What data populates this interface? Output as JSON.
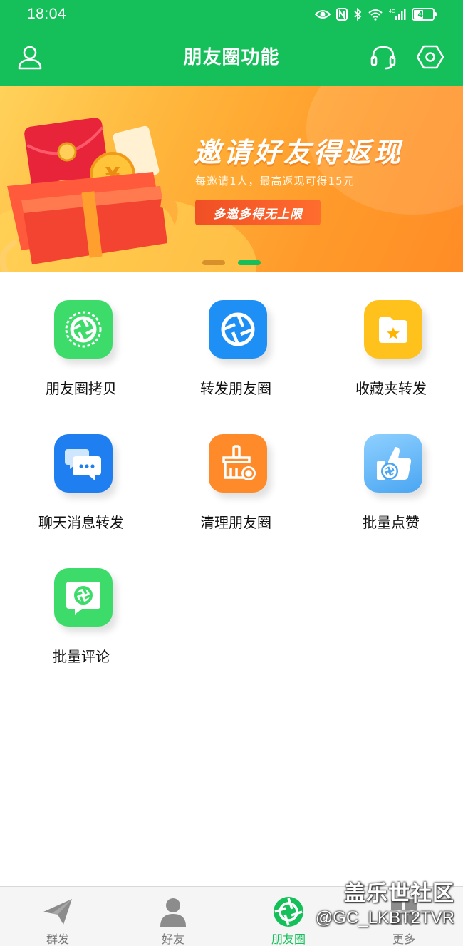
{
  "status_bar": {
    "time": "18:04",
    "network": "4G",
    "battery": "47"
  },
  "header": {
    "title": "朋友圈功能",
    "left_icon": "user-icon",
    "right_icons": [
      "headset-icon",
      "settings-hexagon-icon"
    ],
    "color": "#15c05a"
  },
  "banner": {
    "headline": "邀请好友得返现",
    "subtitle": "每邀请1人，最高返现可得15元",
    "button_label": "多邀多得无上限",
    "active_slide": 2,
    "slide_count": 2
  },
  "features": [
    {
      "label": "朋友圈拷贝",
      "icon": "shutter-copy-icon",
      "color": "#3ddc6a"
    },
    {
      "label": "转发朋友圈",
      "icon": "shutter-forward-icon",
      "color": "#1e8ff5"
    },
    {
      "label": "收藏夹转发",
      "icon": "folder-star-icon",
      "color": "#ffc21c"
    },
    {
      "label": "聊天消息转发",
      "icon": "chat-bubbles-icon",
      "color": "#1f7ef0"
    },
    {
      "label": "清理朋友圈",
      "icon": "broom-clean-icon",
      "color": "#ff8a2a"
    },
    {
      "label": "批量点赞",
      "icon": "thumbs-up-icon",
      "color": "#5ab2f7"
    },
    {
      "label": "批量评论",
      "icon": "comment-shutter-icon",
      "color": "#3ddc6a"
    }
  ],
  "bottom_nav": [
    {
      "label": "群发",
      "icon": "paper-plane-icon",
      "active": false
    },
    {
      "label": "好友",
      "icon": "person-icon",
      "active": false
    },
    {
      "label": "朋友圈",
      "icon": "moments-shutter-icon",
      "active": true
    },
    {
      "label": "更多",
      "icon": "more-icon",
      "active": false
    }
  ],
  "watermark": {
    "line1": "盖乐世社区",
    "line2": "@GC_LKBT2TVR"
  }
}
